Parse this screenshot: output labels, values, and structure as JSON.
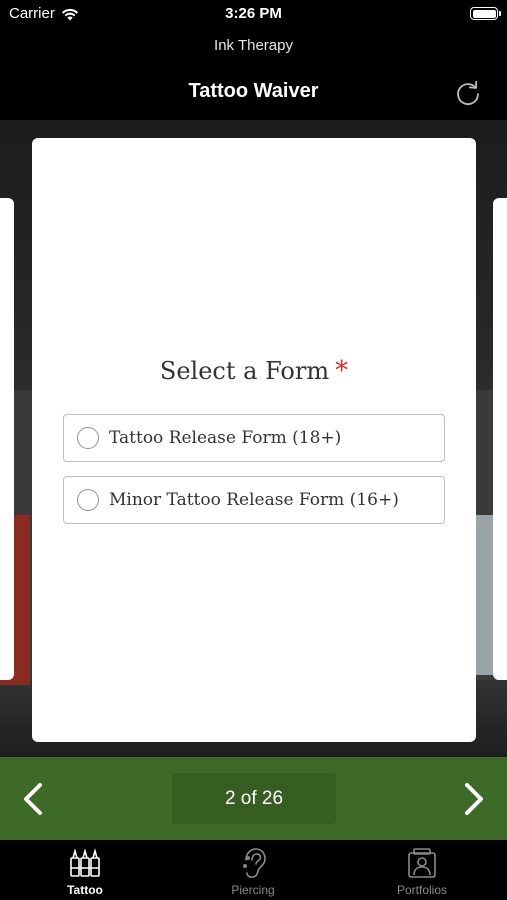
{
  "status_bar": {
    "carrier": "Carrier",
    "time": "3:26 PM"
  },
  "header": {
    "shop_name": "Ink Therapy",
    "title": "Tattoo Waiver",
    "refresh_icon": "refresh-icon"
  },
  "form": {
    "title": "Select a Form",
    "required_mark": "*",
    "options": [
      {
        "label": "Tattoo Release Form (18+)",
        "selected": false
      },
      {
        "label": "Minor Tattoo Release Form (16+)",
        "selected": false
      }
    ]
  },
  "pager": {
    "current": "2",
    "of_text": "of 26",
    "prev_icon": "chevron-left-icon",
    "next_icon": "chevron-right-icon"
  },
  "tabs": [
    {
      "label": "Tattoo",
      "icon": "tattoo-ink-bottles-icon",
      "active": true
    },
    {
      "label": "Piercing",
      "icon": "ear-piercing-icon",
      "active": false
    },
    {
      "label": "Portfolios",
      "icon": "portfolio-icon",
      "active": false
    }
  ],
  "colors": {
    "accent_green": "#3d6a27",
    "required_red": "#d0302c"
  }
}
